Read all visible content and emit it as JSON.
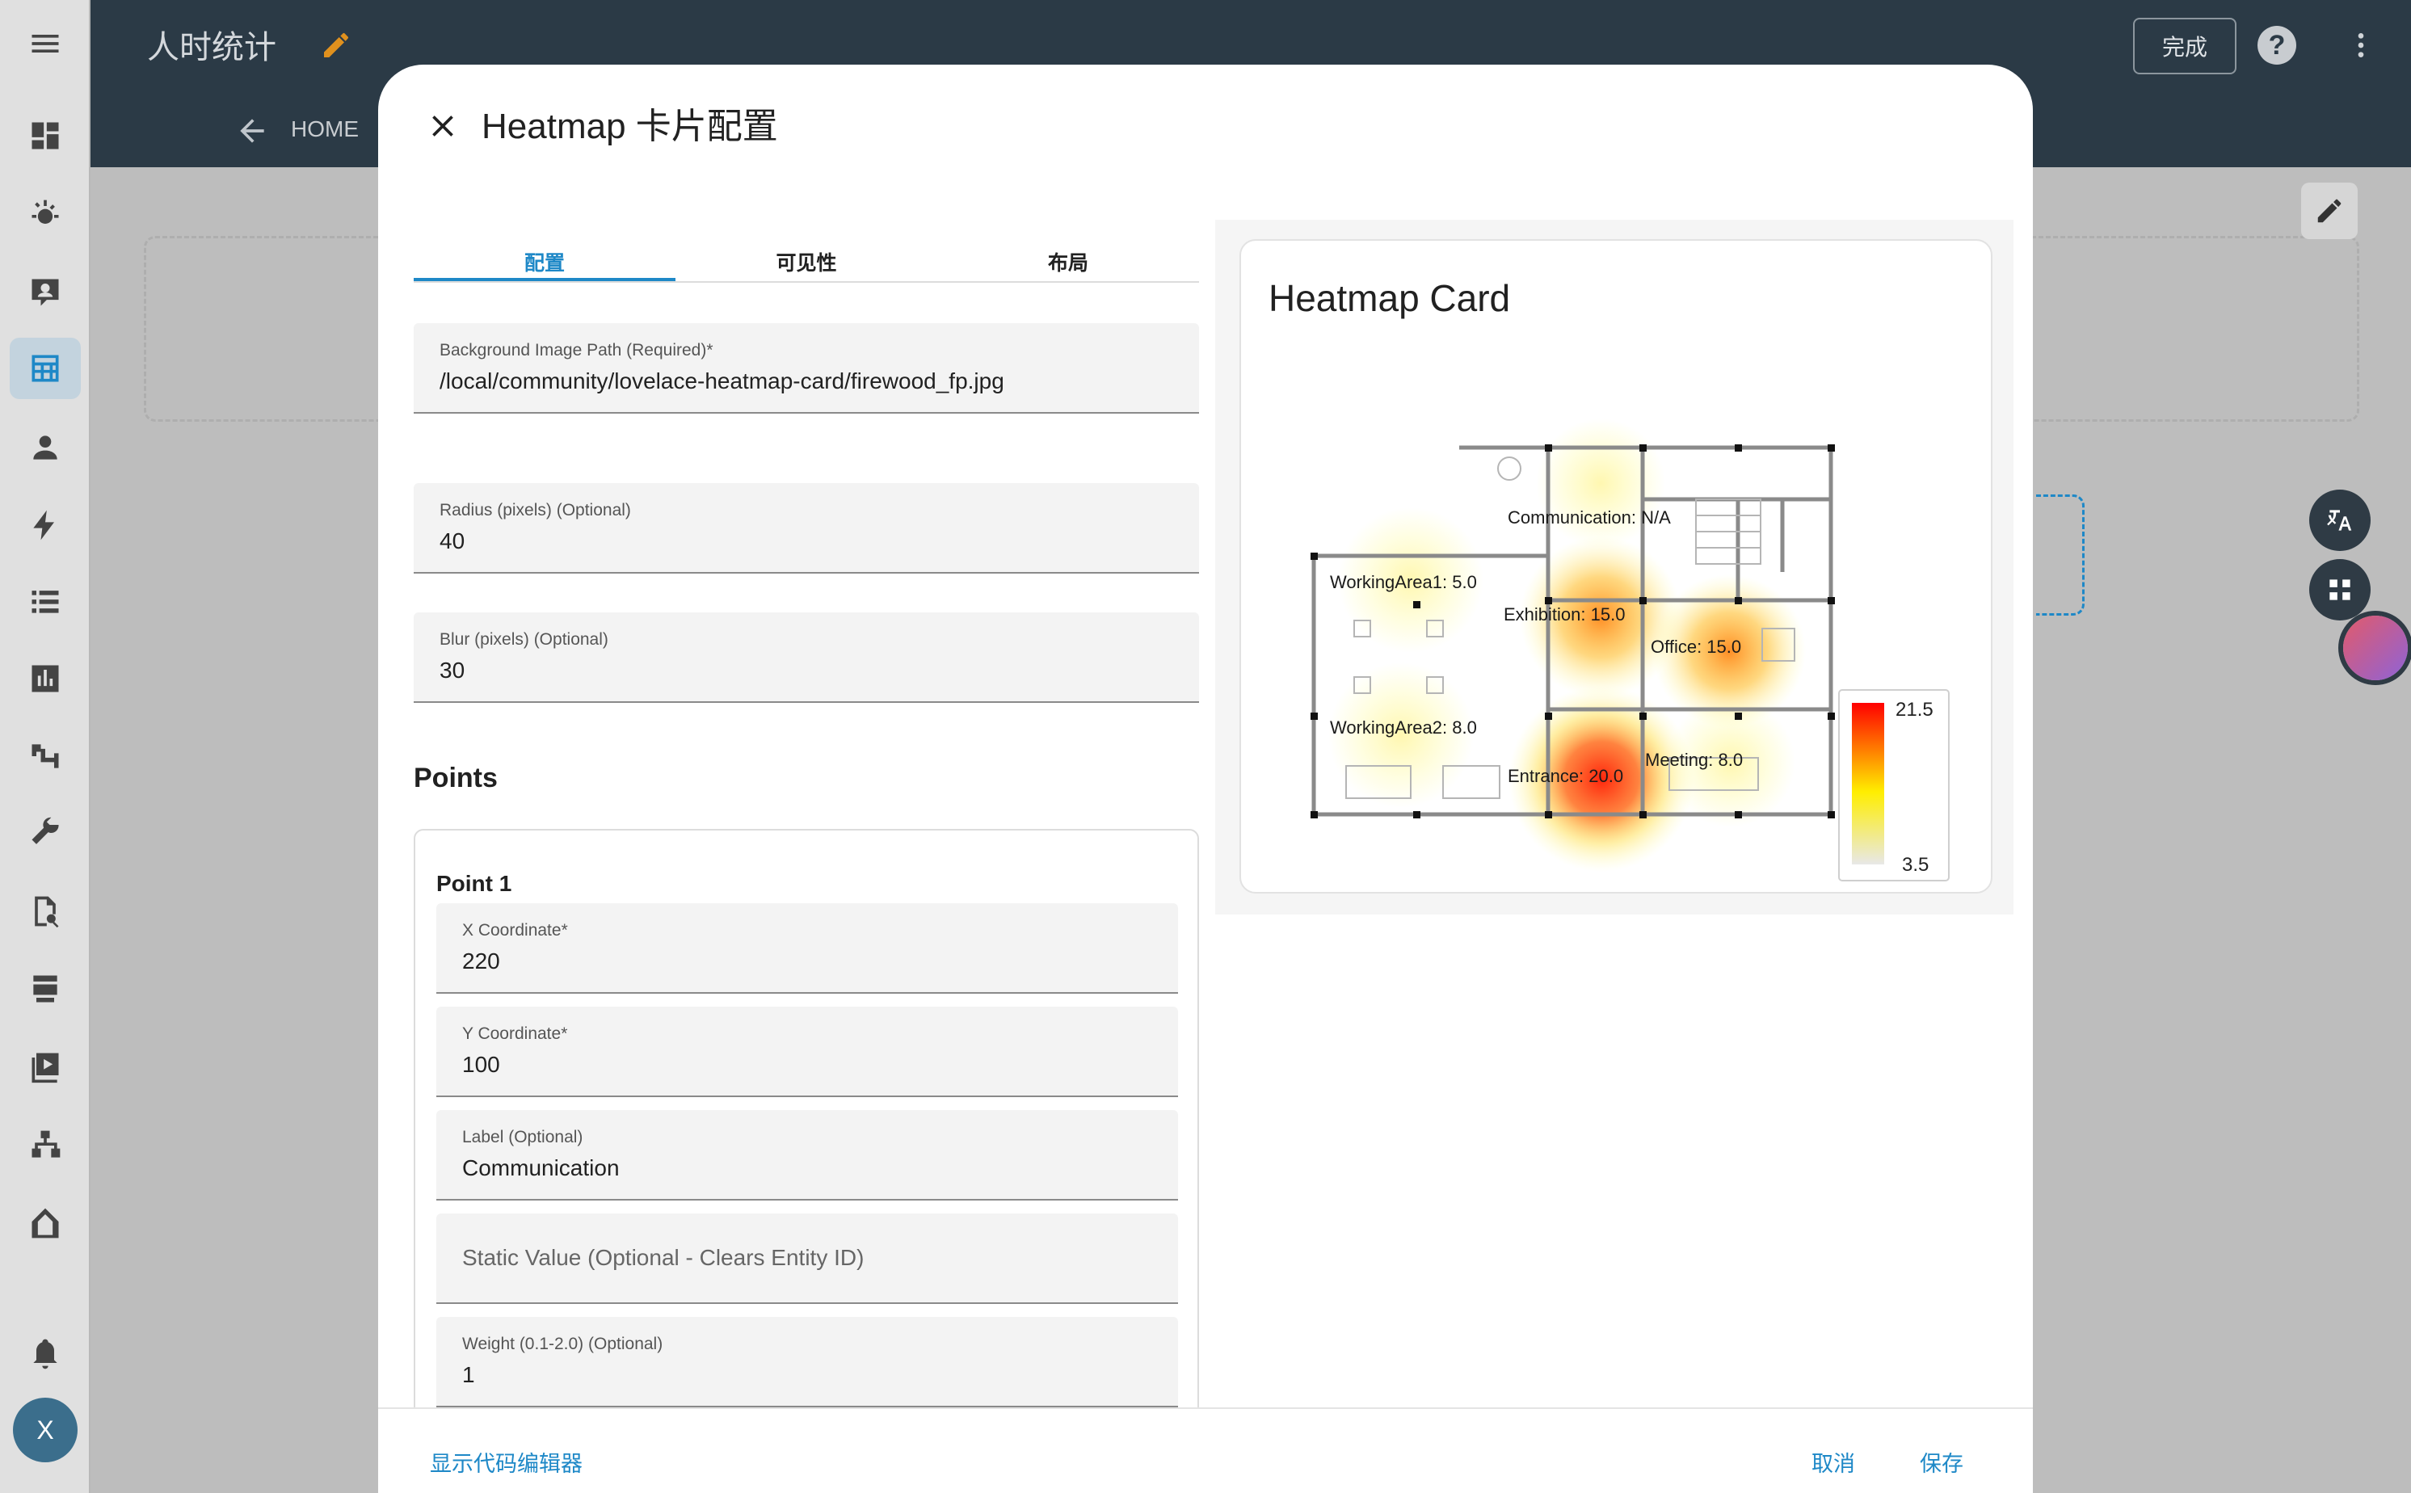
{
  "topbar": {
    "title": "人时统计",
    "done_label": "完成"
  },
  "nav": {
    "back_label": "HOME"
  },
  "user": {
    "initial": "X"
  },
  "dialog": {
    "title": "Heatmap 卡片配置",
    "tabs": [
      "配置",
      "可见性",
      "布局"
    ],
    "fields": {
      "background": {
        "label": "Background Image Path (Required)*",
        "value": "/local/community/lovelace-heatmap-card/firewood_fp.jpg"
      },
      "radius": {
        "label": "Radius (pixels) (Optional)",
        "value": "40"
      },
      "blur": {
        "label": "Blur (pixels) (Optional)",
        "value": "30"
      }
    },
    "points_heading": "Points",
    "point1": {
      "title": "Point 1",
      "x": {
        "label": "X Coordinate*",
        "value": "220"
      },
      "y": {
        "label": "Y Coordinate*",
        "value": "100"
      },
      "label": {
        "label": "Label (Optional)",
        "value": "Communication"
      },
      "static_value": {
        "placeholder": "Static Value (Optional - Clears Entity ID)"
      },
      "weight": {
        "label": "Weight (0.1-2.0) (Optional)",
        "value": "1"
      }
    },
    "footer": {
      "code_editor": "显示代码编辑器",
      "cancel": "取消",
      "save": "保存"
    }
  },
  "preview": {
    "card_title": "Heatmap Card",
    "labels": [
      "Communication: N/A",
      "WorkingArea1: 5.0",
      "Exhibition: 15.0",
      "Office: 15.0",
      "WorkingArea2: 8.0",
      "Meeting: 8.0",
      "Entrance: 20.0"
    ],
    "legend": {
      "max": "21.5",
      "min": "3.5"
    }
  },
  "colors": {
    "accent": "#1e88c7",
    "topbar": "#2b3a46",
    "edit_icon": "#e0911e"
  }
}
